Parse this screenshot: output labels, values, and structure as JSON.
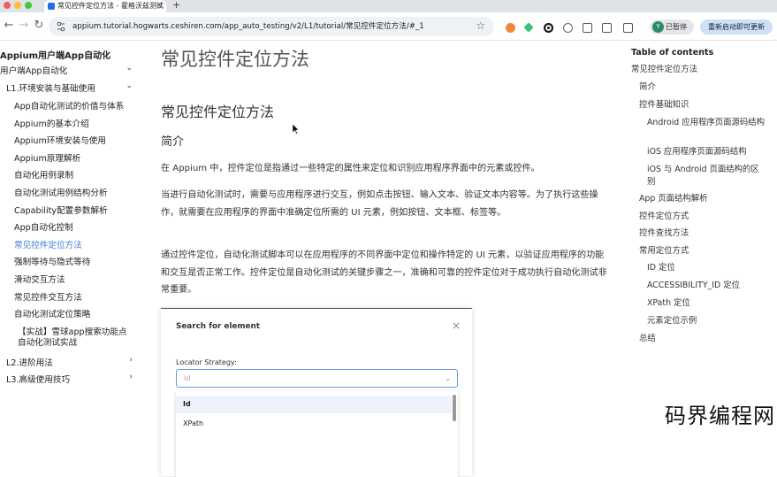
{
  "browser": {
    "tab_title": "常见控件定位方法 - 霍格沃兹测试",
    "url": "appium.tutorial.hogwarts.ceshiren.com/app_auto_testing/v2/L1/tutorial/常见控件定位方法/#_1",
    "profile_initial": "Y",
    "profile_label": "已暂停",
    "restart_label": "重新启动即可更新"
  },
  "sidebar": {
    "title": "Appium用户端App自动化",
    "section": "用户端App自动化",
    "group": "L1.环境安装与基础使用",
    "items": [
      "App自动化测试的价值与体系",
      "Appium的基本介绍",
      "Appium环境安装与使用",
      "Appium原理解析",
      "自动化用例录制",
      "自动化测试用例结构分析",
      "Capability配置参数解析",
      "App自动化控制",
      "常见控件定位方法",
      "强制等待与隐式等待",
      "滑动交互方法",
      "常见控件交互方法",
      "自动化测试定位策略",
      "【实战】雪球app搜索功能点",
      "自动化测试实战"
    ],
    "active_item": "常见控件定位方法",
    "group2": "L2.进阶用法",
    "group3": "L3.高级使用技巧"
  },
  "main": {
    "h1": "常见控件定位方法",
    "h2": "常见控件定位方法",
    "h3": "简介",
    "p1": "在 Appium 中，控件定位是指通过一些特定的属性来定位和识别应用程序界面中的元素或控件。",
    "p2": "当进行自动化测试时，需要与应用程序进行交互，例如点击按钮、输入文本、验证文本内容等。为了执行这些操作，就需要在应用程序的界面中准确定位所需的 UI 元素，例如按钮、文本框、标签等。",
    "p3": "通过控件定位，自动化测试脚本可以在应用程序的不同界面中定位和操作特定的 UI 元素，以验证应用程序的功能和交互是否正常工作。控件定位是自动化测试的关键步骤之一，准确和可靠的控件定位对于成功执行自动化测试非常重要。",
    "dialog": {
      "title": "Search for element",
      "label": "Locator Strategy:",
      "selected": "Id",
      "options": [
        "Id",
        "XPath"
      ]
    }
  },
  "toc": {
    "title": "Table of contents",
    "items": [
      {
        "label": "常见控件定位方法",
        "level": 0
      },
      {
        "label": "简介",
        "level": 1
      },
      {
        "label": "控件基础知识",
        "level": 1
      },
      {
        "label": "Android 应用程序页面源码结构",
        "level": 2
      },
      {
        "label": "iOS 应用程序页面源码结构",
        "level": 2
      },
      {
        "label": "iOS 与 Android 页面结构的区别",
        "level": 2
      },
      {
        "label": "App 页面结构解析",
        "level": 1
      },
      {
        "label": "控件定位方式",
        "level": 1
      },
      {
        "label": "控件查找方法",
        "level": 1
      },
      {
        "label": "常用定位方式",
        "level": 1
      },
      {
        "label": "ID 定位",
        "level": 2
      },
      {
        "label": "ACCESSIBILITY_ID 定位",
        "level": 2
      },
      {
        "label": "XPath 定位",
        "level": 2
      },
      {
        "label": "元素定位示例",
        "level": 2
      },
      {
        "label": "总结",
        "level": 1
      }
    ]
  },
  "watermark": "码界编程网",
  "colors": {
    "accent": "#3b7ad8",
    "chrome_bg": "#dfe3e8",
    "omnibox_bg": "#eef1f5"
  }
}
